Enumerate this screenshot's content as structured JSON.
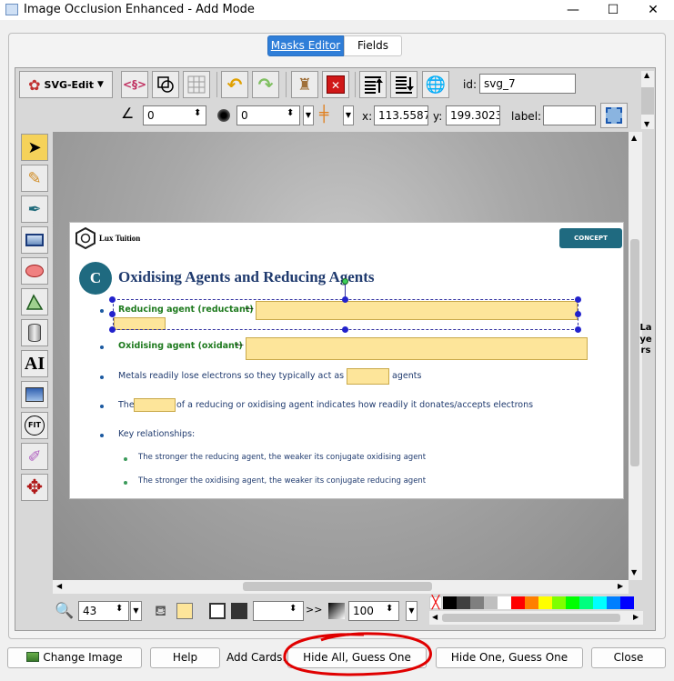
{
  "window": {
    "title": "Image Occlusion Enhanced - Add Mode",
    "minimize": "—",
    "maximize": "☐",
    "close": "✕"
  },
  "tabs": [
    {
      "label": "Masks Editor",
      "active": true
    },
    {
      "label": "Fields",
      "active": false
    }
  ],
  "toolbar": {
    "svg_edit_label": "SVG-Edit",
    "id_label": "id:",
    "id_value": "svg_7",
    "angle_value": "0",
    "blur_value": "0",
    "x_label": "x:",
    "x_value": "113.5587",
    "y_label": "y:",
    "y_value": "199.3023",
    "label_label": "label:",
    "label_value": ""
  },
  "left_tools": [
    "select-tool",
    "pencil-tool",
    "pen-tool",
    "rect-tool",
    "ellipse-tool",
    "polygon-tool",
    "shape-library-tool",
    "text-tool",
    "image-tool",
    "zoom-fit-tool",
    "eyedropper-tool",
    "pan-tool"
  ],
  "fit_label": "FIT",
  "text_tool_glyph": "AI",
  "layers_label": "Layers",
  "slide": {
    "logo_text": "Lux Tuition",
    "badge": "CONCEPT",
    "circle_letter": "C",
    "heading": "Oxidising Agents and Reducing Agents",
    "bullet1_label": "Reducing agent (reductant)",
    "bullet2_label": "Oxidising agent (oxidant)",
    "dash": "—",
    "bullet3_text_a": "Metals readily lose electrons so they typically act as",
    "bullet3_text_b": "agents",
    "bullet4_text_a": "The",
    "bullet4_text_b": "of a reducing or oxidising agent indicates how readily it donates/accepts electrons",
    "bullet5_text": "Key relationships:",
    "sub1": "The stronger the reducing agent, the weaker its conjugate oxidising agent",
    "sub2": "The stronger the oxidising agent, the weaker its conjugate reducing agent"
  },
  "bottom_bar": {
    "zoom_value": "43",
    "opacity_value": "100",
    "stroke_width_value": "",
    "palette": [
      "#000000",
      "#3f3f3f",
      "#7f7f7f",
      "#bfbfbf",
      "#ffffff",
      "#ff0000",
      "#ff7f00",
      "#ffff00",
      "#7fff00",
      "#00ff00",
      "#00ff7f",
      "#00ffff",
      "#007fff",
      "#0000ff"
    ],
    "fill_color": "#fde59a"
  },
  "buttons": {
    "change_image": "Change Image",
    "help": "Help",
    "add_cards_label": "Add Cards:",
    "hide_all": "Hide All, Guess One",
    "hide_one": "Hide One, Guess One",
    "close": "Close"
  }
}
